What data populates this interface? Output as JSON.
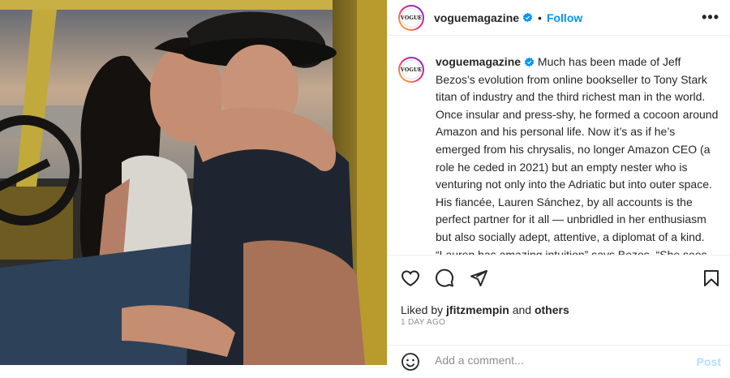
{
  "post": {
    "username": "voguemagazine",
    "avatar_text": "VOGUE",
    "follow_label": "Follow",
    "separator": "•",
    "more_label": "•••",
    "caption_username": "voguemagazine",
    "caption_text": "Much has been made of Jeff Bezos’s evolution from online bookseller to Tony Stark titan of industry and the third richest man in the world. Once insular and press-shy, he formed a cocoon around Amazon and his personal life. Now it’s as if he’s emerged from his chrysalis, no longer Amazon CEO (a role he ceded in 2021) but an empty nester who is venturing not only into the Adriatic but into outer space. His fiancée, Lauren Sánchez, by all accounts is the perfect partner for it all — unbridled in her enthusiasm but also socially adept, attentive, a diplomat of a kind. “Lauren has amazing intuition” says Bezos. “She sees things that",
    "liked_by_prefix": "Liked by",
    "liked_by_user": "jfitzmempin",
    "liked_by_and": "and",
    "liked_by_others": "others",
    "date": "1 DAY AGO",
    "comment_placeholder": "Add a comment...",
    "post_label": "Post"
  },
  "icons": {
    "like": "heart-icon",
    "comment": "comment-icon",
    "share": "send-icon",
    "save": "bookmark-icon",
    "emoji": "smiley-icon",
    "verified": "verified-badge-icon"
  },
  "colors": {
    "link": "#0095f6",
    "verified": "#0095f6",
    "muted": "#8e8e8e",
    "post_disabled": "#b2dffc"
  }
}
